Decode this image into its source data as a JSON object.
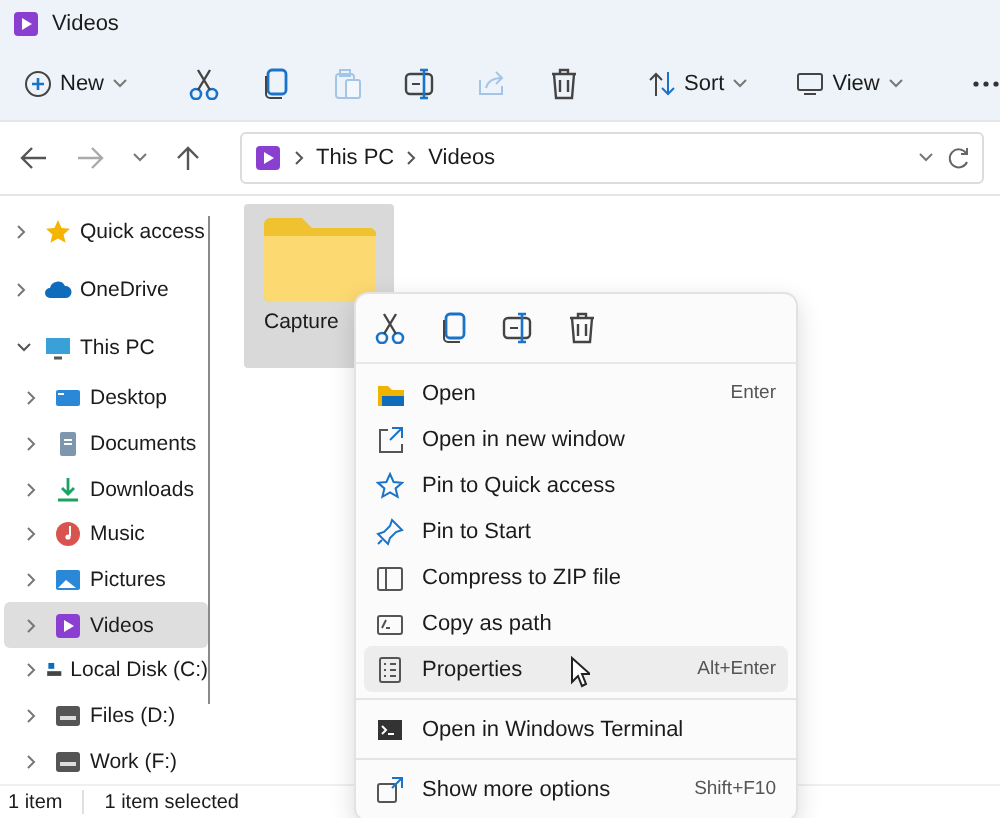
{
  "window": {
    "title": "Videos"
  },
  "toolbar": {
    "new": {
      "label": "New"
    },
    "actions": [
      {
        "disabled": false
      },
      {
        "disabled": false
      },
      {
        "disabled": true
      },
      {
        "disabled": false
      },
      {
        "disabled": true
      },
      {
        "disabled": false
      }
    ],
    "sort": {
      "label": "Sort"
    },
    "view": {
      "label": "View"
    }
  },
  "address": {
    "crumbs": [
      "This PC",
      "Videos"
    ]
  },
  "sidebar": {
    "items": [
      {
        "label": "Quick access",
        "expanded": false,
        "selected": false
      },
      {
        "label": "OneDrive",
        "expanded": false,
        "selected": false
      },
      {
        "label": "This PC",
        "expanded": true,
        "selected": false,
        "children": [
          {
            "label": "Desktop",
            "expanded": false,
            "selected": false
          },
          {
            "label": "Documents",
            "expanded": false,
            "selected": false
          },
          {
            "label": "Downloads",
            "expanded": false,
            "selected": false
          },
          {
            "label": "Music",
            "expanded": false,
            "selected": false
          },
          {
            "label": "Pictures",
            "expanded": false,
            "selected": false
          },
          {
            "label": "Videos",
            "expanded": false,
            "selected": true
          },
          {
            "label": "Local Disk (C:)",
            "expanded": false,
            "selected": false
          },
          {
            "label": "Files (D:)",
            "expanded": false,
            "selected": false
          },
          {
            "label": "Work (F:)",
            "expanded": false,
            "selected": false
          }
        ]
      }
    ]
  },
  "files": [
    {
      "name": "Capture",
      "selected": true
    }
  ],
  "context_menu": {
    "sections": [
      [
        {
          "label": "Open",
          "shortcut": "Enter",
          "hovered": false
        },
        {
          "label": "Open in new window",
          "hovered": false
        },
        {
          "label": "Pin to Quick access",
          "hovered": false
        },
        {
          "label": "Pin to Start",
          "hovered": false
        },
        {
          "label": "Compress to ZIP file",
          "hovered": false
        },
        {
          "label": "Copy as path",
          "hovered": false
        },
        {
          "label": "Properties",
          "shortcut": "Alt+Enter",
          "hovered": true
        }
      ],
      [
        {
          "label": "Open in Windows Terminal",
          "hovered": false
        }
      ],
      [
        {
          "label": "Show more options",
          "shortcut": "Shift+F10",
          "hovered": false
        }
      ]
    ]
  },
  "status_bar": {
    "items": [
      "1 item",
      "1 item selected"
    ]
  }
}
